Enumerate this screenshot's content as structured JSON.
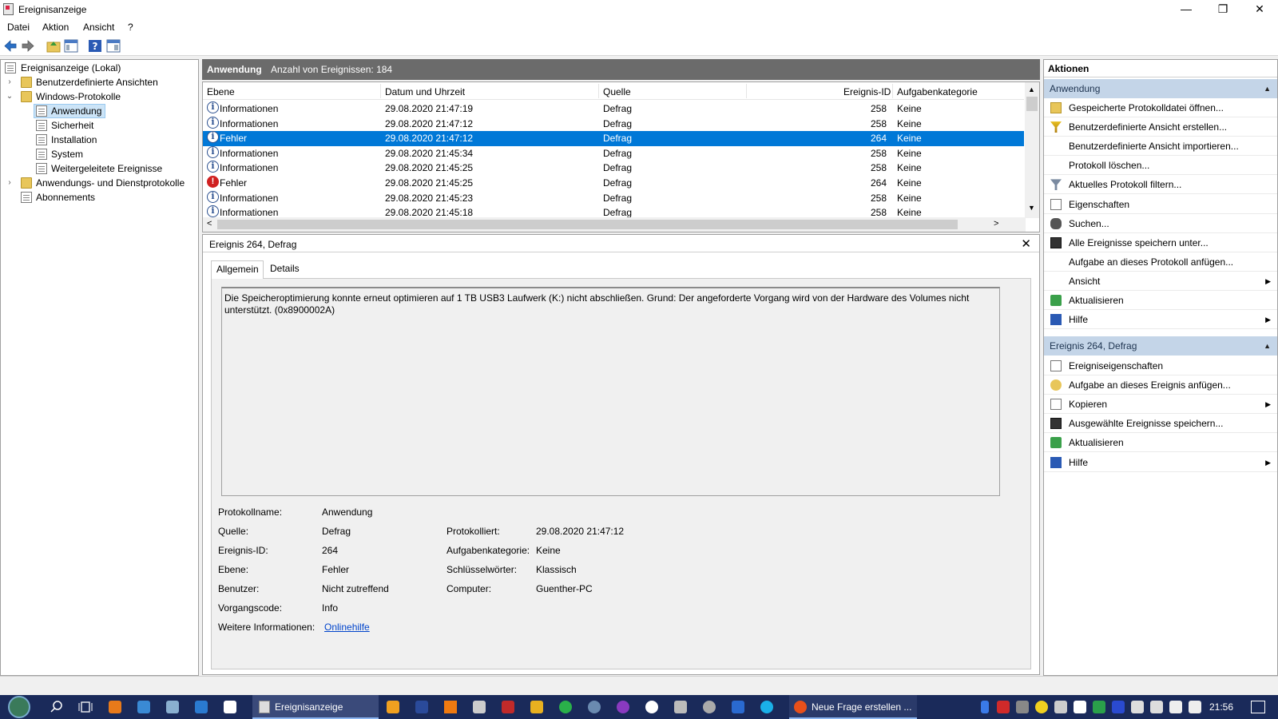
{
  "window": {
    "title": "Ereignisanzeige",
    "minimize": "—",
    "restore": "❐",
    "close": "✕"
  },
  "menu": {
    "file": "Datei",
    "action": "Aktion",
    "view": "Ansicht",
    "help": "?"
  },
  "tree": {
    "root": "Ereignisanzeige (Lokal)",
    "custom_views": "Benutzerdefinierte Ansichten",
    "windows_logs": "Windows-Protokolle",
    "application": "Anwendung",
    "security": "Sicherheit",
    "setup": "Installation",
    "system": "System",
    "forwarded": "Weitergeleitete Ereignisse",
    "app_service_logs": "Anwendungs- und Dienstprotokolle",
    "subscriptions": "Abonnements"
  },
  "main": {
    "log_name": "Anwendung",
    "event_count": "Anzahl von Ereignissen: 184"
  },
  "grid": {
    "columns": {
      "level": "Ebene",
      "date": "Datum und Uhrzeit",
      "source": "Quelle",
      "id": "Ereignis-ID",
      "category": "Aufgabenkategorie"
    },
    "rows": [
      {
        "level": "Informationen",
        "date": "29.08.2020 21:47:19",
        "source": "Defrag",
        "id": "258",
        "category": "Keine",
        "type": "info"
      },
      {
        "level": "Informationen",
        "date": "29.08.2020 21:47:12",
        "source": "Defrag",
        "id": "258",
        "category": "Keine",
        "type": "info"
      },
      {
        "level": "Fehler",
        "date": "29.08.2020 21:47:12",
        "source": "Defrag",
        "id": "264",
        "category": "Keine",
        "type": "info"
      },
      {
        "level": "Informationen",
        "date": "29.08.2020 21:45:34",
        "source": "Defrag",
        "id": "258",
        "category": "Keine",
        "type": "info"
      },
      {
        "level": "Informationen",
        "date": "29.08.2020 21:45:25",
        "source": "Defrag",
        "id": "258",
        "category": "Keine",
        "type": "info"
      },
      {
        "level": "Fehler",
        "date": "29.08.2020 21:45:25",
        "source": "Defrag",
        "id": "264",
        "category": "Keine",
        "type": "error"
      },
      {
        "level": "Informationen",
        "date": "29.08.2020 21:45:23",
        "source": "Defrag",
        "id": "258",
        "category": "Keine",
        "type": "info"
      },
      {
        "level": "Informationen",
        "date": "29.08.2020 21:45:18",
        "source": "Defrag",
        "id": "258",
        "category": "Keine",
        "type": "info"
      }
    ],
    "selected_row": 2
  },
  "detail": {
    "title": "Ereignis 264, Defrag",
    "tab_general": "Allgemein",
    "tab_details": "Details",
    "message": "Die Speicheroptimierung konnte erneut optimieren auf 1 TB USB3  Laufwerk (K:) nicht abschließen. Grund: Der angeforderte Vorgang wird von der Hardware des Volumes nicht unterstützt. (0x8900002A)",
    "labels": {
      "log_name": "Protokollname:",
      "source": "Quelle:",
      "event_id": "Ereignis-ID:",
      "level": "Ebene:",
      "user": "Benutzer:",
      "opcode": "Vorgangscode:",
      "more_info": "Weitere Informationen:",
      "logged": "Protokolliert:",
      "task_category": "Aufgabenkategorie:",
      "keywords": "Schlüsselwörter:",
      "computer": "Computer:"
    },
    "values": {
      "log_name": "Anwendung",
      "source": "Defrag",
      "event_id": "264",
      "level": "Fehler",
      "user": "Nicht zutreffend",
      "opcode": "Info",
      "more_info": "Onlinehilfe",
      "logged": "29.08.2020 21:47:12",
      "task_category": "Keine",
      "keywords": "Klassisch",
      "computer": "Guenther-PC"
    }
  },
  "actions": {
    "header": "Aktionen",
    "section1": "Anwendung",
    "items1": [
      "Gespeicherte Protokolldatei öffnen...",
      "Benutzerdefinierte Ansicht erstellen...",
      "Benutzerdefinierte Ansicht importieren...",
      "Protokoll löschen...",
      "Aktuelles Protokoll filtern...",
      "Eigenschaften",
      "Suchen...",
      "Alle Ereignisse speichern unter...",
      "Aufgabe an dieses Protokoll anfügen...",
      "Ansicht",
      "Aktualisieren",
      "Hilfe"
    ],
    "section2": "Ereignis 264, Defrag",
    "items2": [
      "Ereigniseigenschaften",
      "Aufgabe an dieses Ereignis anfügen...",
      "Kopieren",
      "Ausgewählte Ereignisse speichern...",
      "Aktualisieren",
      "Hilfe"
    ]
  },
  "taskbar": {
    "active_app": "Ereignisanzeige",
    "browser_app": "Neue Frage erstellen ...",
    "clock": "21:56"
  },
  "colors": {
    "selection": "#0078d7",
    "section_header": "#c4d5e8",
    "taskbar": "#1a2a5a"
  }
}
